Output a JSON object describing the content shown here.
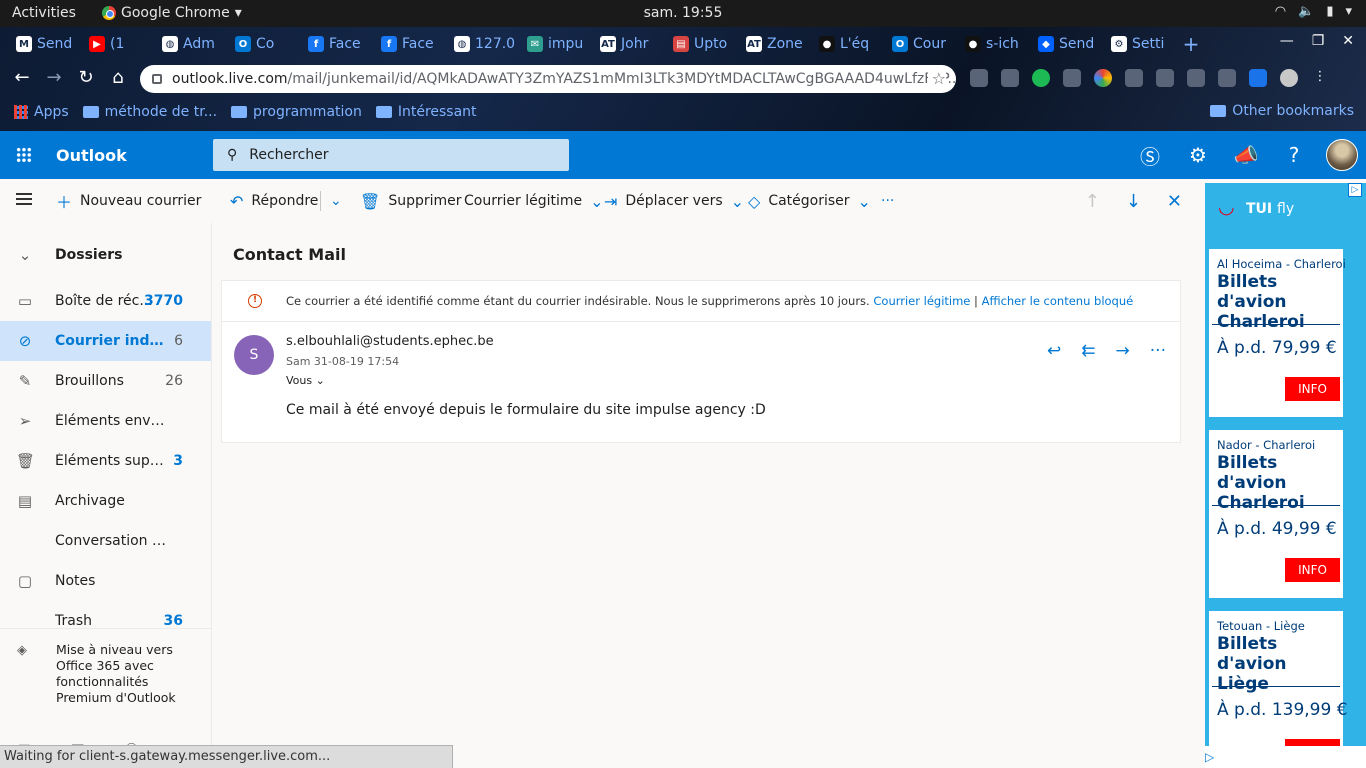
{
  "os": {
    "activities": "Activities",
    "app_name": "Google Chrome",
    "clock": "sam. 19:55"
  },
  "browser": {
    "tabs": [
      {
        "label": "Send",
        "icon": "gmail-icon",
        "color": "#ffffff"
      },
      {
        "label": "(1",
        "icon": "youtube-icon",
        "color": "#ff0000"
      },
      {
        "label": "Adm",
        "icon": "globe-icon",
        "color": "#ffffff"
      },
      {
        "label": "Co",
        "icon": "outlook-icon",
        "color": "#0078d4"
      },
      {
        "label": "Face",
        "icon": "facebook-icon",
        "color": "#1877f2"
      },
      {
        "label": "Face",
        "icon": "facebook-icon",
        "color": "#1877f2"
      },
      {
        "label": "127.0",
        "icon": "globe-icon",
        "color": "#ffffff"
      },
      {
        "label": "impu",
        "icon": "mail-icon",
        "color": "#2e9e8f"
      },
      {
        "label": "Johr",
        "icon": "at-icon",
        "color": "#ffffff"
      },
      {
        "label": "Upto",
        "icon": "popcorn-icon",
        "color": "#d64541"
      },
      {
        "label": "Zone",
        "icon": "at-icon",
        "color": "#ffffff"
      },
      {
        "label": "L'éq",
        "icon": "github-icon",
        "color": "#111111"
      },
      {
        "label": "Cour",
        "icon": "outlook-icon",
        "color": "#0078d4"
      },
      {
        "label": "s-ich",
        "icon": "github-icon",
        "color": "#111111"
      },
      {
        "label": "Send",
        "icon": "dropbox-icon",
        "color": "#0061ff"
      },
      {
        "label": "Setti",
        "icon": "gear-icon",
        "color": "#ffffff"
      }
    ],
    "new_tab": "+",
    "url_host": "outlook.live.com",
    "url_path": "/mail/junkemail/id/AQMkADAwATY3ZmYAZS1mMmI3LTk3MDYtMDACLTAwCgBGAAAD4uwLfzF5P...",
    "bookmarks": [
      {
        "label": "Apps",
        "icon": "apps-grid-icon"
      },
      {
        "label": "méthode de tr...",
        "icon": "folder-icon"
      },
      {
        "label": "programmation",
        "icon": "folder-icon"
      },
      {
        "label": "Intéressant",
        "icon": "folder-icon"
      }
    ],
    "other_bookmarks": "Other bookmarks",
    "status_text": "Waiting for client-s.gateway.messenger.live.com..."
  },
  "outlook": {
    "brand": "Outlook",
    "search_placeholder": "Rechercher",
    "toolbar": {
      "new_mail": "Nouveau courrier",
      "reply": "Répondre",
      "delete": "Supprimer",
      "not_junk": "Courrier légitime",
      "move_to": "Déplacer vers",
      "categorize": "Catégoriser",
      "more": "···"
    },
    "folders_header": "Dossiers",
    "folders": [
      {
        "label": "Boîte de réc...",
        "count": "3770",
        "icon": "inbox-icon",
        "bold_count": true
      },
      {
        "label": "Courrier indésir...",
        "count": "6",
        "icon": "blocked-icon",
        "selected": true
      },
      {
        "label": "Brouillons",
        "count": "26",
        "icon": "pencil-icon"
      },
      {
        "label": "Éléments envoyés",
        "count": "",
        "icon": "send-icon"
      },
      {
        "label": "Éléments suppri...",
        "count": "3",
        "icon": "trash-icon",
        "bold_count": true
      },
      {
        "label": "Archivage",
        "count": "",
        "icon": "archive-icon"
      },
      {
        "label": "Conversation Hist...",
        "count": "",
        "icon": ""
      },
      {
        "label": "Notes",
        "count": "",
        "icon": "note-icon"
      },
      {
        "label": "Trash",
        "count": "36",
        "icon": "",
        "bold_count": true
      }
    ],
    "upgrade_text": "Mise à niveau vers Office 365 avec fonctionnalités Premium d'Outlook",
    "message": {
      "subject": "Contact Mail",
      "junk_notice": "Ce courrier a été identifié comme étant du courrier indésirable. Nous le supprimerons après 10 jours.",
      "junk_link_legit": "Courrier légitime",
      "junk_separator": "|",
      "junk_link_show": "Afficher le contenu bloqué",
      "sender_initial": "S",
      "sender": "s.elbouhlali@students.ephec.be",
      "date": "Sam 31-08-19 17:54",
      "to": "Vous",
      "body": "Ce mail à été envoyé depuis le formulaire du site impulse agency :D"
    }
  },
  "ad": {
    "brand": "TUI",
    "brand_sub": "fly",
    "cards": [
      {
        "route": "Al Hoceima - Charleroi",
        "title": "Billets d'avion Charleroi",
        "price": "À p.d. 79,99 €",
        "cta": "INFO"
      },
      {
        "route": "Nador - Charleroi",
        "title": "Billets d'avion Charleroi",
        "price": "À p.d. 49,99 €",
        "cta": "INFO"
      },
      {
        "route": "Tetouan - Liège",
        "title": "Billets d'avion Liège",
        "price": "À p.d. 139,99 €",
        "cta": "INFO"
      }
    ]
  }
}
